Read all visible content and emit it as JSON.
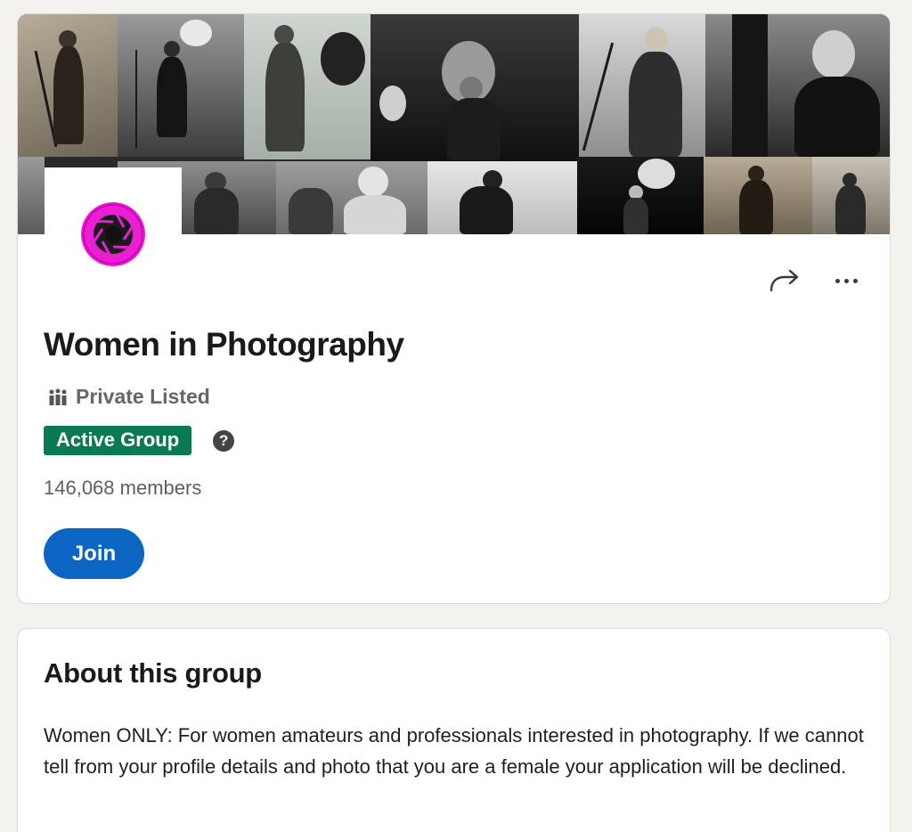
{
  "group": {
    "name": "Women in Photography",
    "privacy": "Private Listed",
    "badge": "Active Group",
    "members": "146,068 members",
    "join_label": "Join",
    "help_glyph": "?",
    "logo_color": "#e91fd1",
    "badge_color": "#0a7a53",
    "join_color": "#0a66c2"
  },
  "actions": {
    "share_icon": "share-arrow-icon",
    "more_icon": "ellipsis-icon"
  },
  "about": {
    "title": "About this group",
    "description": "Women ONLY: For women amateurs and professionals interested in photography. If we cannot tell from your profile details and photo that you are a female your application will be declined."
  }
}
